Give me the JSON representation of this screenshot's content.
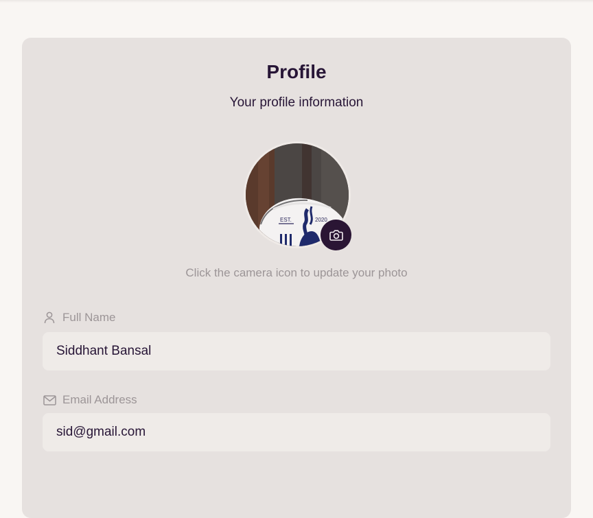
{
  "profile": {
    "title": "Profile",
    "subtitle": "Your profile information",
    "photo_hint": "Click the camera icon to update your photo",
    "avatar": {
      "badge_left": "EST.",
      "badge_right": "2020"
    },
    "icons": {
      "camera": "camera-icon",
      "user": "user-icon",
      "mail": "mail-icon"
    }
  },
  "fields": {
    "full_name": {
      "label": "Full Name",
      "value": "Siddhant Bansal"
    },
    "email": {
      "label": "Email Address",
      "value": "sid@gmail.com"
    }
  },
  "colors": {
    "page_bg": "#f9f6f3",
    "card_bg": "#e6e1df",
    "input_bg": "#efebe8",
    "text_primary": "#271536",
    "text_muted": "#9c9597",
    "camera_button": "#2a1534"
  }
}
